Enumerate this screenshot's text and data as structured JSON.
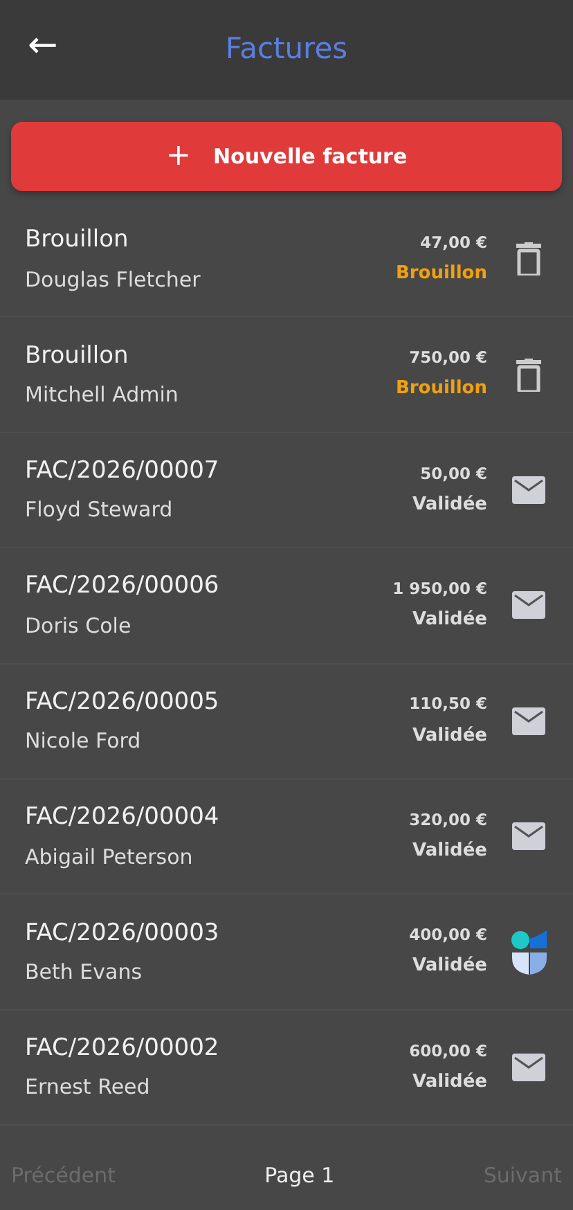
{
  "header": {
    "back": "←",
    "title": "Factures"
  },
  "new_button": {
    "icon": "+",
    "label": "Nouvelle facture"
  },
  "invoices": [
    {
      "number": "Brouillon",
      "customer": "Douglas Fletcher",
      "amount": "47,00 €",
      "status": "Brouillon",
      "draft": true,
      "kind": "delete"
    },
    {
      "number": "Brouillon",
      "customer": "Mitchell Admin",
      "amount": "750,00 €",
      "status": "Brouillon",
      "draft": true,
      "kind": "delete"
    },
    {
      "number": "FAC/2026/00007",
      "customer": "Floyd Steward",
      "amount": "50,00 €",
      "status": "Validée",
      "draft": false,
      "kind": "mail"
    },
    {
      "number": "FAC/2026/00006",
      "customer": "Doris Cole",
      "amount": "1 950,00 €",
      "status": "Validée",
      "draft": false,
      "kind": "mail"
    },
    {
      "number": "FAC/2026/00005",
      "customer": "Nicole Ford",
      "amount": "110,50 €",
      "status": "Validée",
      "draft": false,
      "kind": "mail"
    },
    {
      "number": "FAC/2026/00004",
      "customer": "Abigail Peterson",
      "amount": "320,00 €",
      "status": "Validée",
      "draft": false,
      "kind": "mail"
    },
    {
      "number": "FAC/2026/00003",
      "customer": "Beth Evans",
      "amount": "400,00 €",
      "status": "Validée",
      "draft": false,
      "kind": "app"
    },
    {
      "number": "FAC/2026/00002",
      "customer": "Ernest Reed",
      "amount": "600,00 €",
      "status": "Validée",
      "draft": false,
      "kind": "mail"
    }
  ],
  "pager": {
    "previous": {
      "label": "Précédent",
      "disabled": true
    },
    "page": "Page 1",
    "next": {
      "label": "Suivant",
      "disabled": true
    }
  }
}
